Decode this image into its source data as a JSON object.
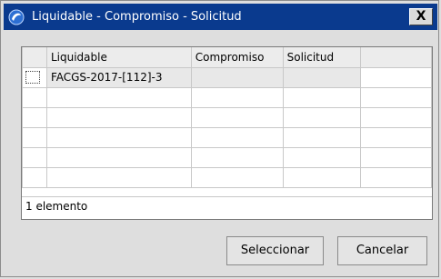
{
  "window": {
    "title": "Liquidable - Compromiso - Solicitud",
    "close_label": "X"
  },
  "grid": {
    "columns": [
      "",
      "Liquidable",
      "Compromiso",
      "Solicitud",
      ""
    ],
    "rows": [
      [
        "FACGS-2017-[112]-3",
        "",
        "",
        ""
      ]
    ],
    "status_text": "1 elemento"
  },
  "buttons": {
    "select_label": "Seleccionar",
    "cancel_label": "Cancelar"
  },
  "colors": {
    "titlebar": "#0a3a8e",
    "background": "#dedede"
  }
}
